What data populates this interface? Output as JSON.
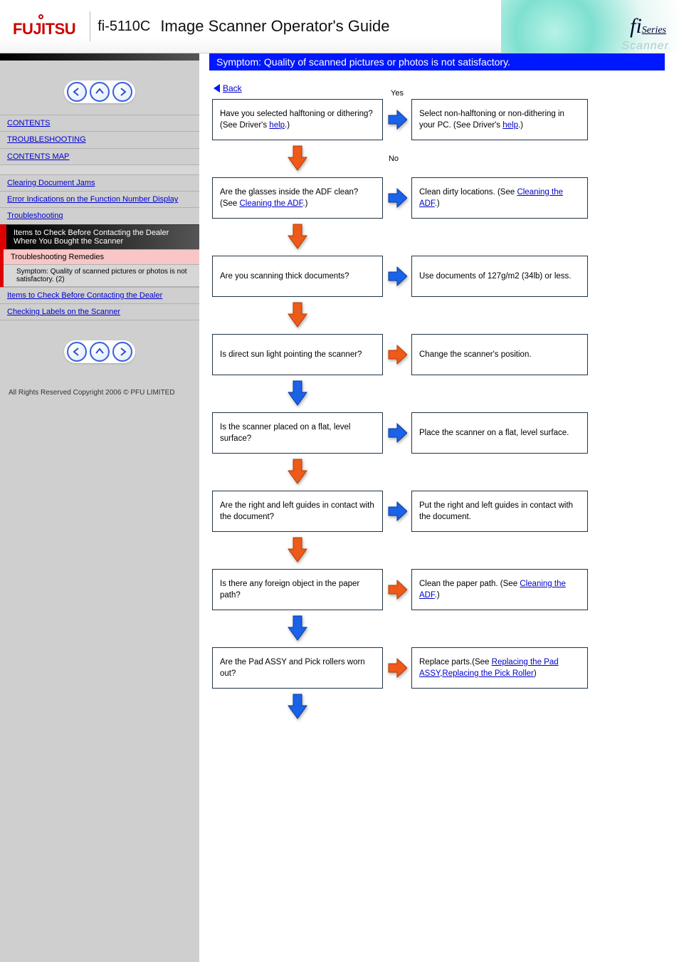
{
  "header": {
    "brand": "FUJITSU",
    "model": "fi-5110C",
    "title": "Image Scanner Operator's Guide",
    "series_logo_fi": "fi",
    "series_logo_series": "Series",
    "scanner_word": "Scanner"
  },
  "sidebar": {
    "nav_prev": "◄",
    "nav_up": "▲",
    "nav_next": "►",
    "items_top": [
      "CONTENTS",
      "TROUBLESHOOTING",
      "CONTENTS MAP"
    ],
    "spacer1": "",
    "items_mid": [
      "Clearing Document Jams",
      "Error Indications on the Function Number Display",
      "Troubleshooting"
    ],
    "section_header": "Items to Check Before Contacting the Dealer Where You Bought the Scanner",
    "current": "Troubleshooting Remedies",
    "subsections": [
      "Symptom: Quality of scanned pictures or photos is not satisfactory. (2)"
    ],
    "items_bot": [
      "Items to Check Before Contacting the Dealer",
      "Checking Labels on the Scanner"
    ],
    "copyright": "All Rights Reserved Copyright 2006 © PFU LIMITED"
  },
  "main": {
    "title": "Symptom: Quality of scanned pictures or photos is not satisfactory.",
    "back_label": "Back",
    "yes": "Yes",
    "no": "No",
    "steps": [
      {
        "q_parts": [
          "Have you selected halftoning or dithering? (See Driver's ",
          {
            "link": "help"
          },
          ".)"
        ],
        "a_parts": [
          "Select non-halftoning or non-dithering in your PC. (See Driver's ",
          {
            "link": "help"
          },
          ".)"
        ],
        "h_color": "blue",
        "v_color": "orange"
      },
      {
        "q_parts": [
          "Are the glasses inside the ADF clean? (See ",
          {
            "link": "Cleaning the ADF"
          },
          ".)"
        ],
        "a_parts": [
          "Clean dirty locations. (See ",
          {
            "link": "Cleaning the ADF"
          },
          ".)"
        ],
        "h_color": "blue",
        "v_color": "orange"
      },
      {
        "q_parts": [
          "Are you scanning thick documents?"
        ],
        "a_parts": [
          "Use documents of 127g/m2 (34lb) or less."
        ],
        "h_color": "blue",
        "v_color": "orange"
      },
      {
        "q_parts": [
          "Is direct sun light pointing the scanner?"
        ],
        "a_parts": [
          "Change the scanner's position."
        ],
        "h_color": "orange",
        "v_color": "blue"
      },
      {
        "q_parts": [
          "Is the scanner placed on a flat, level surface?"
        ],
        "a_parts": [
          "Place the scanner on a flat, level surface."
        ],
        "h_color": "blue",
        "v_color": "orange"
      },
      {
        "q_parts": [
          "Are the right and left guides in contact with the document?"
        ],
        "a_parts": [
          "Put the right and left guides in contact with the document."
        ],
        "h_color": "blue",
        "v_color": "orange"
      },
      {
        "q_parts": [
          "Is there any foreign object in the paper path?"
        ],
        "a_parts": [
          "Clean the paper path. (See ",
          {
            "link": "Cleaning the ADF"
          },
          ".)"
        ],
        "h_color": "orange",
        "v_color": "blue"
      },
      {
        "q_parts": [
          "Are the Pad ASSY and Pick rollers worn out?"
        ],
        "a_parts": [
          "Replace parts.(See ",
          {
            "link": "Replacing the Pad ASSY"
          },
          ",",
          {
            "link": "Replacing the Pick Roller"
          },
          ")"
        ],
        "h_color": "orange",
        "v_color": "blue"
      }
    ]
  }
}
